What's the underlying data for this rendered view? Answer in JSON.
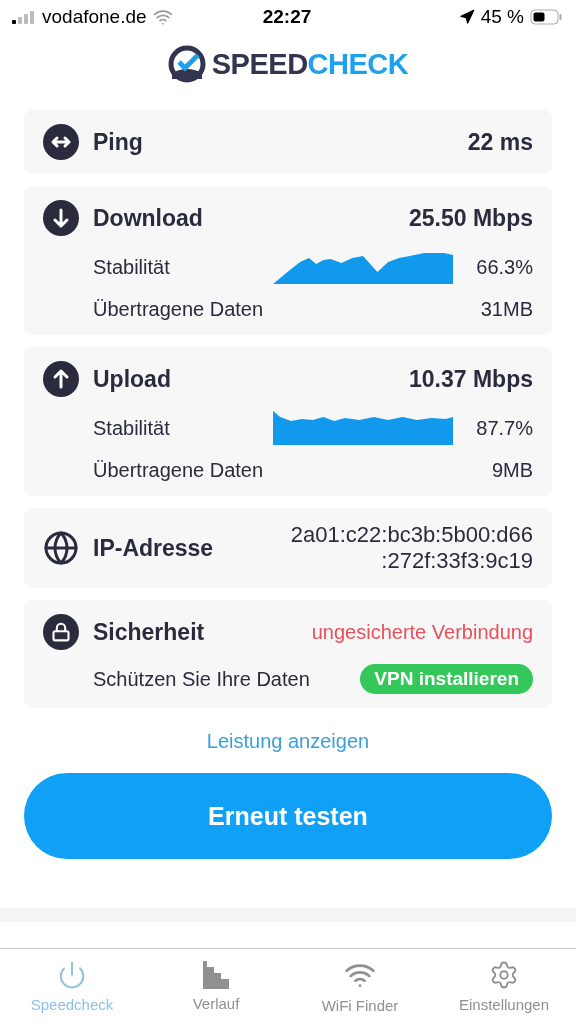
{
  "status_bar": {
    "carrier": "vodafone.de",
    "time": "22:27",
    "battery": "45 %"
  },
  "logo": {
    "part_1": "SPEED",
    "part_2": "CHECK"
  },
  "ping": {
    "label": "Ping",
    "value": "22 ms"
  },
  "download": {
    "label": "Download",
    "value": "25.50 Mbps",
    "stability_label": "Stabilität",
    "stability": "66.3%",
    "data_label": "Übertragene Daten",
    "data": "31MB"
  },
  "upload": {
    "label": "Upload",
    "value": "10.37 Mbps",
    "stability_label": "Stabilität",
    "stability": "87.7%",
    "data_label": "Übertragene Daten",
    "data": "9MB"
  },
  "ip": {
    "label": "IP-Adresse",
    "value_line_1": "2a01:c22:bc3b:5b00:d66",
    "value_line_2": ":272f:33f3:9c19"
  },
  "security": {
    "label": "Sicherheit",
    "status": "ungesicherte Verbindung",
    "protect_label": "Schützen Sie Ihre Daten",
    "vpn_button": "VPN installieren"
  },
  "performance_link": "Leistung anzeigen",
  "retest_button": "Erneut testen",
  "tabs": [
    {
      "label": "Speedcheck",
      "selected": true,
      "kind": "power"
    },
    {
      "label": "Verlauf",
      "selected": false,
      "kind": "history"
    },
    {
      "label": "WiFi Finder",
      "selected": false,
      "kind": "wifi"
    },
    {
      "label": "Einstellungen",
      "selected": false,
      "kind": "gear"
    }
  ]
}
